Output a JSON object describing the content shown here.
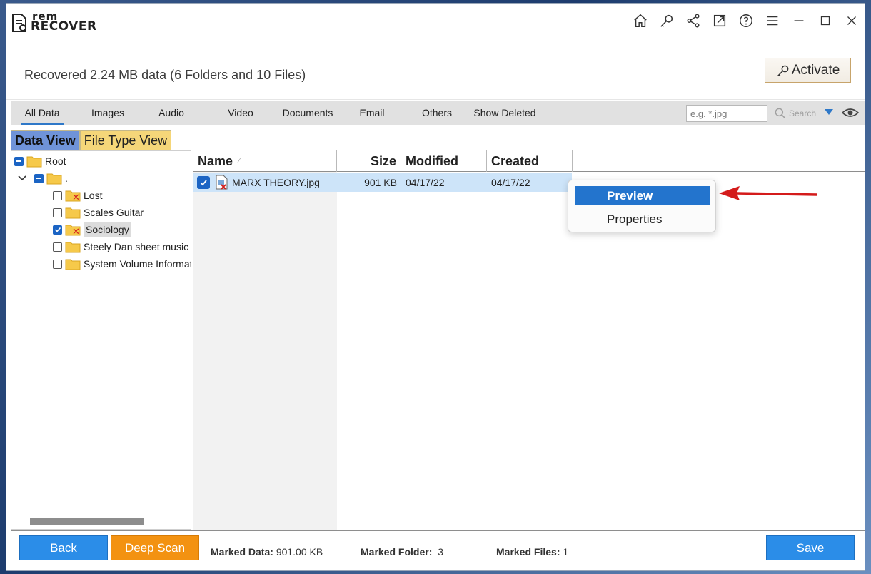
{
  "app": {
    "logo_top": "rem",
    "logo_bottom": "RECOVER",
    "title_icons": [
      "home-icon",
      "key-icon",
      "share-icon",
      "open-external-icon",
      "help-icon",
      "menu-icon",
      "minimize-icon",
      "maximize-icon",
      "close-icon"
    ]
  },
  "header": {
    "recovered_text": "Recovered 2.24 MB data (6 Folders and 10 Files)",
    "activate_label": "Activate"
  },
  "filters": {
    "tabs": [
      "All Data",
      "Images",
      "Audio",
      "Video",
      "Documents",
      "Email",
      "Others",
      "Show Deleted"
    ],
    "active": "All Data",
    "search_placeholder": "e.g. *.jpg",
    "search_label": "Search"
  },
  "view_tabs": {
    "data_view": "Data View",
    "file_type_view": "File Type View"
  },
  "tree": {
    "root": "Root",
    "dot": ".",
    "folders": [
      {
        "name": "Lost",
        "deleted": true,
        "checked": false
      },
      {
        "name": "Scales Guitar",
        "deleted": false,
        "checked": false
      },
      {
        "name": "Sociology",
        "deleted": true,
        "checked": true
      },
      {
        "name": "Steely Dan sheet music k",
        "deleted": false,
        "checked": false
      },
      {
        "name": "System Volume Informat",
        "deleted": false,
        "checked": false
      }
    ]
  },
  "file_list": {
    "columns": [
      "Name",
      "Size",
      "Modified",
      "Created"
    ],
    "rows": [
      {
        "name": "MARX THEORY.jpg",
        "size": "901 KB",
        "modified": "04/17/22",
        "created": "04/17/22"
      }
    ]
  },
  "context_menu": {
    "preview": "Preview",
    "properties": "Properties"
  },
  "bottom": {
    "back_label": "Back",
    "deep_scan_label": "Deep Scan",
    "marked_data_label": "Marked Data:",
    "marked_data_value": "901.00 KB",
    "marked_folder_label": "Marked Folder:",
    "marked_folder_value": "3",
    "marked_files_label": "Marked Files:",
    "marked_files_value": "1",
    "save_label": "Save"
  },
  "colors": {
    "accent_blue": "#2b8de8",
    "deep_scan_orange": "#f39211",
    "menu_highlight": "#2374cd",
    "activate_border": "#c7a46b",
    "deleted_mark": "#d21f1f"
  }
}
